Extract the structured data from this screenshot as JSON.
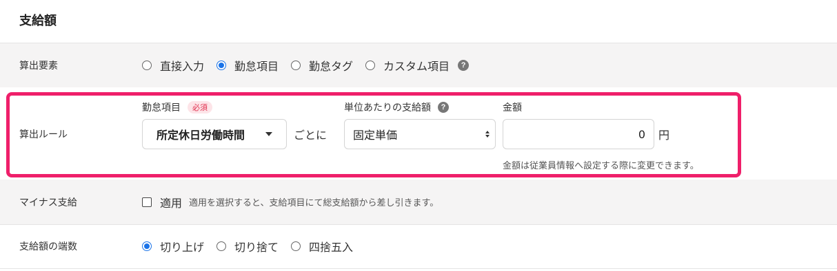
{
  "section_title": "支給額",
  "calc_element": {
    "label": "算出要素",
    "options": [
      {
        "label": "直接入力",
        "selected": false
      },
      {
        "label": "勤怠項目",
        "selected": true
      },
      {
        "label": "勤怠タグ",
        "selected": false
      },
      {
        "label": "カスタム項目",
        "selected": false
      }
    ],
    "help_icon": "?"
  },
  "calc_rule": {
    "label": "算出ルール",
    "attendance_item": {
      "label": "勤怠項目",
      "required_badge": "必須",
      "value": "所定休日労働時間"
    },
    "per_text": "ごとに",
    "unit_amount": {
      "label": "単位あたりの支給額",
      "help_icon": "?",
      "value": "固定単価"
    },
    "amount": {
      "label": "金額",
      "value": "0",
      "unit": "円",
      "hint": "金額は従業員情報へ設定する際に変更できます。"
    }
  },
  "minus_pay": {
    "label": "マイナス支給",
    "checkbox_label": "適用",
    "checked": false,
    "description": "適用を選択すると、支給項目にて総支給額から差し引きます。"
  },
  "rounding": {
    "label": "支給額の端数",
    "options": [
      {
        "label": "切り上げ",
        "selected": true
      },
      {
        "label": "切り捨て",
        "selected": false
      },
      {
        "label": "四捨五入",
        "selected": false
      }
    ]
  },
  "colors": {
    "accent": "#1a73e8",
    "highlight_border": "#ef1f6a",
    "row_shade": "#f5f4f4"
  }
}
